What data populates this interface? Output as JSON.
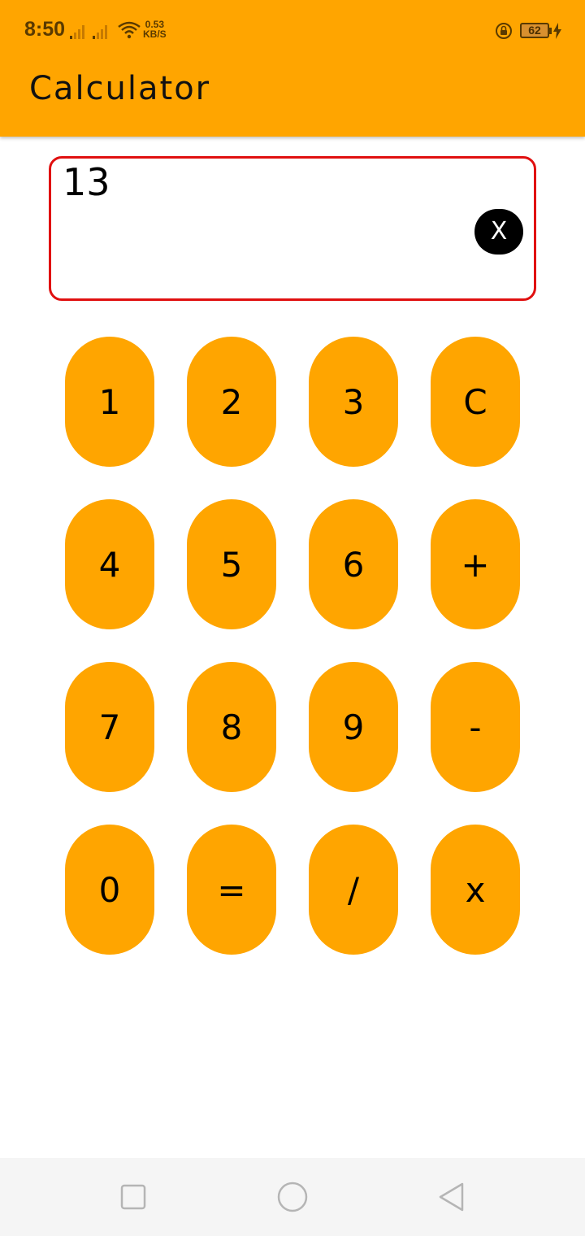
{
  "status_bar": {
    "time": "8:50",
    "net_speed_value": "0.53",
    "net_speed_unit": "KB/S",
    "battery_level": "62",
    "icons": [
      "signal-icon",
      "signal-icon",
      "wifi-icon",
      "rotation-lock-icon",
      "battery-icon",
      "charging-icon"
    ]
  },
  "app_bar": {
    "title": "Calculator",
    "color": "#FFA500"
  },
  "display": {
    "value": "13",
    "clear_label": "X",
    "border_color": "#E01010"
  },
  "keypad": {
    "button_color": "#FFA500",
    "keys": [
      {
        "label": "1",
        "name": "key-1"
      },
      {
        "label": "2",
        "name": "key-2"
      },
      {
        "label": "3",
        "name": "key-3"
      },
      {
        "label": "C",
        "name": "key-clear"
      },
      {
        "label": "4",
        "name": "key-4"
      },
      {
        "label": "5",
        "name": "key-5"
      },
      {
        "label": "6",
        "name": "key-6"
      },
      {
        "label": "+",
        "name": "key-plus"
      },
      {
        "label": "7",
        "name": "key-7"
      },
      {
        "label": "8",
        "name": "key-8"
      },
      {
        "label": "9",
        "name": "key-9"
      },
      {
        "label": "-",
        "name": "key-minus"
      },
      {
        "label": "0",
        "name": "key-0"
      },
      {
        "label": "=",
        "name": "key-equals"
      },
      {
        "label": "/",
        "name": "key-divide"
      },
      {
        "label": "x",
        "name": "key-multiply"
      }
    ]
  },
  "nav_bar": {
    "icons": [
      "recents-square-icon",
      "home-circle-icon",
      "back-triangle-icon"
    ]
  }
}
